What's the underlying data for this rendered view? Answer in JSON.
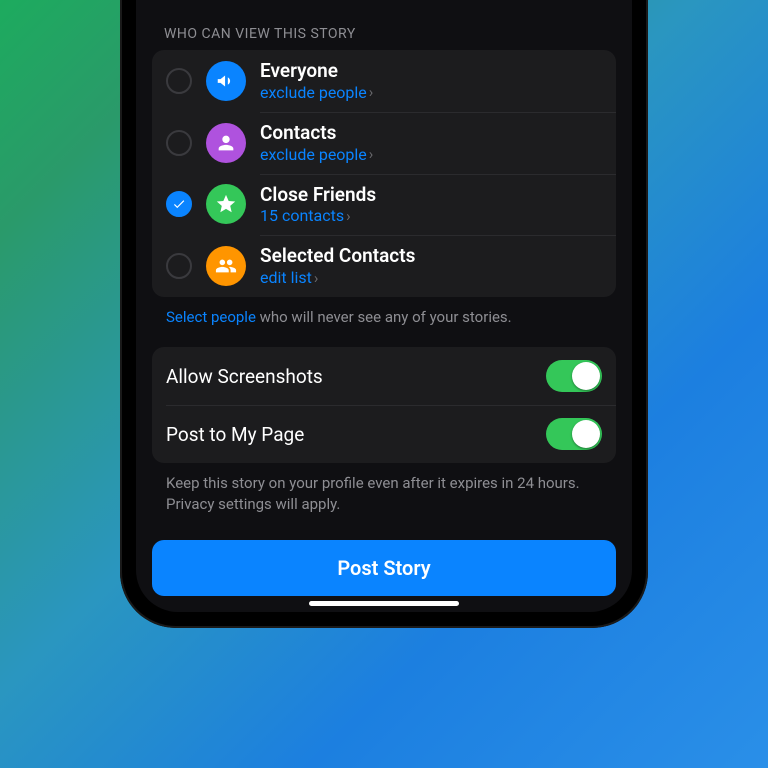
{
  "sectionHeader": "WHO CAN VIEW THIS STORY",
  "audiences": {
    "everyone": {
      "title": "Everyone",
      "sub": "exclude people",
      "selected": false
    },
    "contacts": {
      "title": "Contacts",
      "sub": "exclude people",
      "selected": false
    },
    "close": {
      "title": "Close Friends",
      "sub": "15 contacts",
      "selected": true
    },
    "selected": {
      "title": "Selected Contacts",
      "sub": "edit list",
      "selected": false
    }
  },
  "footerLink": "Select people",
  "footerRest": " who will never see any of your stories.",
  "toggles": {
    "screenshots": {
      "label": "Allow Screenshots",
      "on": true
    },
    "postpage": {
      "label": "Post to My Page",
      "on": true
    }
  },
  "toggleFooter": "Keep this story on your profile even after it expires in 24 hours. Privacy settings will apply.",
  "postButton": "Post Story"
}
